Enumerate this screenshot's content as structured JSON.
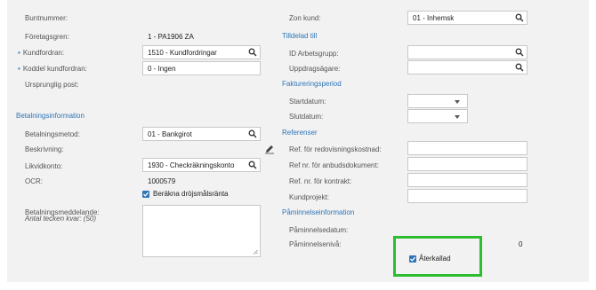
{
  "left": {
    "buntnummer_label": "Buntnummer:",
    "foretagsgren_label": "Företagsgren:",
    "foretagsgren_value": "1 - PA1906 ZA",
    "kundfordran_label": "Kundfordran:",
    "kundfordran_value": "1510 - Kundfordringar",
    "koddel_label": "Koddel kundfordran:",
    "koddel_value": "0 - Ingen",
    "ursprunglig_label": "Ursprunglig post:",
    "betalningsinfo_heading": "Betalningsinformation",
    "betalningsmetod_label": "Betalningsmetod:",
    "betalningsmetod_value": "01 - Bankgirot",
    "beskrivning_label": "Beskrivning:",
    "likvidkonto_label": "Likvidkonto:",
    "likvidkonto_value": "1930 - Checkräkningskonto",
    "ocr_label": "OCR:",
    "ocr_value": "1000579",
    "berakna_label": "Beräkna dröjsmålsränta",
    "meddelande_label": "Betalningsmeddelande:",
    "antal_tecken_label": "Antal tecken kvar: (50)"
  },
  "right": {
    "zon_label": "Zon kund:",
    "zon_value": "01 - Inhemsk",
    "tilldelad_heading": "Tilldelad till",
    "id_arbetsgrupp_label": "ID Arbetsgrupp:",
    "uppdragsagare_label": "Uppdragsägare:",
    "faktureringsperiod_heading": "Faktureringsperiod",
    "startdatum_label": "Startdatum:",
    "slutdatum_label": "Slutdatum:",
    "referenser_heading": "Referenser",
    "ref_redovisning_label": "Ref. för redovisningskostnad:",
    "ref_anbud_label": "Ref nr. för anbudsdokument:",
    "ref_kontrakt_label": "Ref. nr. för kontrakt:",
    "kundprojekt_label": "Kundprojekt:",
    "paminnelse_heading": "Påminnelseinformation",
    "paminnelsedatum_label": "Påminnelsedatum:",
    "paminnelseniva_label": "Påminnelsenivå:",
    "paminnelseniva_value": "0",
    "aterkallad_label": "Återkallad"
  },
  "colors": {
    "accent": "#2e75b6",
    "highlight": "#2ebd2e",
    "panel_bg": "#f2f2f2"
  },
  "icons": {
    "lookup": "search-icon",
    "edit": "pencil-icon",
    "dropdown": "chevron-down-icon",
    "checkbox": "checkmark-icon"
  }
}
